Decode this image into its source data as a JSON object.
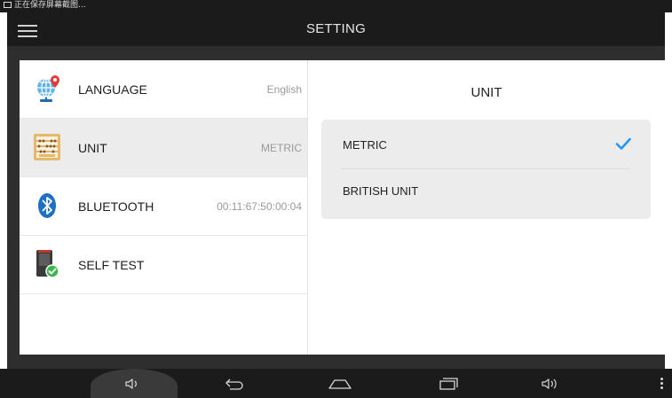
{
  "status_bar": {
    "text": "正在保存屏幕截图..."
  },
  "header": {
    "title": "SETTING"
  },
  "sidebar": {
    "items": [
      {
        "label": "LANGUAGE",
        "value": "English",
        "icon": "globe-pin-icon",
        "selected": false
      },
      {
        "label": "UNIT",
        "value": "METRIC",
        "icon": "abacus-icon",
        "selected": true
      },
      {
        "label": "BLUETOOTH",
        "value": "00:11:67:50:00:04",
        "icon": "bluetooth-icon",
        "selected": false
      },
      {
        "label": "SELF TEST",
        "value": "",
        "icon": "device-check-icon",
        "selected": false
      }
    ]
  },
  "detail": {
    "title": "UNIT",
    "options": [
      {
        "label": "METRIC",
        "checked": true
      },
      {
        "label": "BRITISH UNIT",
        "checked": false
      }
    ]
  },
  "nav_bar": {
    "buttons": [
      "volume-down-icon",
      "back-icon",
      "home-icon",
      "recents-icon",
      "volume-up-icon",
      "more-icon"
    ]
  },
  "colors": {
    "accent": "#2196f3",
    "dark_bar": "#1b1b1b",
    "selected_row": "#ececec"
  }
}
